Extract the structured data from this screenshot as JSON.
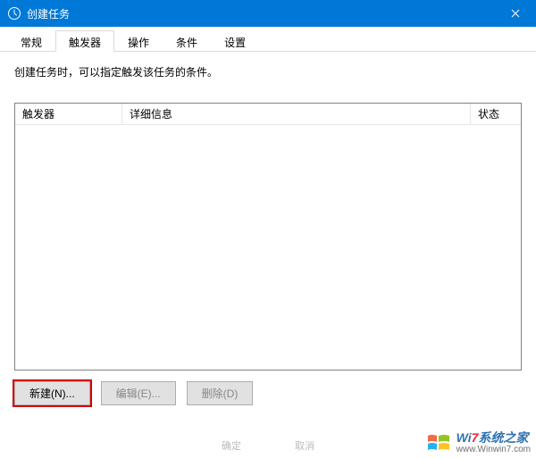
{
  "window": {
    "title": "创建任务"
  },
  "tabs": [
    {
      "label": "常规"
    },
    {
      "label": "触发器"
    },
    {
      "label": "操作"
    },
    {
      "label": "条件"
    },
    {
      "label": "设置"
    }
  ],
  "active_tab_index": 1,
  "description": "创建任务时，可以指定触发该任务的条件。",
  "table": {
    "columns": {
      "trigger": "触发器",
      "detail": "详细信息",
      "status": "状态"
    },
    "rows": []
  },
  "buttons": {
    "new": "新建(N)...",
    "edit": "编辑(E)...",
    "delete": "删除(D)"
  },
  "watermark": {
    "brand_prefix": "Wi",
    "brand_num": "7",
    "brand_suffix": "系统之家",
    "url": "www.Winwin7.com",
    "faint_left": "确定",
    "faint_right": "取消"
  }
}
